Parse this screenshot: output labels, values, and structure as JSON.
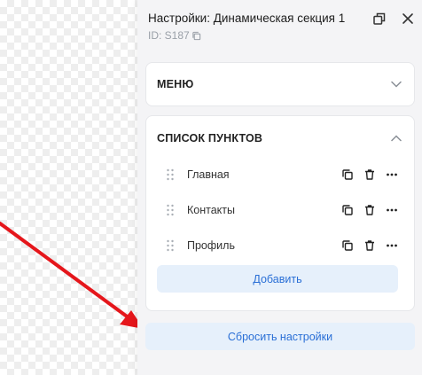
{
  "panel": {
    "title": "Настройки: Динамическая секция 1",
    "id_text": "ID: S187"
  },
  "icons": {
    "open_external": "window-restore-icon",
    "close": "close-icon",
    "copy": "copy-icon",
    "drag": "drag-handle-icon",
    "delete": "trash-icon",
    "more": "more-horizontal-icon",
    "chevron_down": "chevron-down-icon",
    "chevron_up": "chevron-up-icon"
  },
  "menu_section": {
    "title": "МЕНЮ"
  },
  "items_section": {
    "title": "СПИСОК ПУНКТОВ",
    "items": [
      {
        "label": "Главная"
      },
      {
        "label": "Контакты"
      },
      {
        "label": "Профиль"
      }
    ],
    "add_label": "Добавить"
  },
  "reset_label": "Сбросить настройки",
  "colors": {
    "accent": "#2a6fd6",
    "button_bg": "#e6f0fb",
    "panel_bg": "#f4f4f6",
    "annotation_arrow": "#e5161b"
  }
}
